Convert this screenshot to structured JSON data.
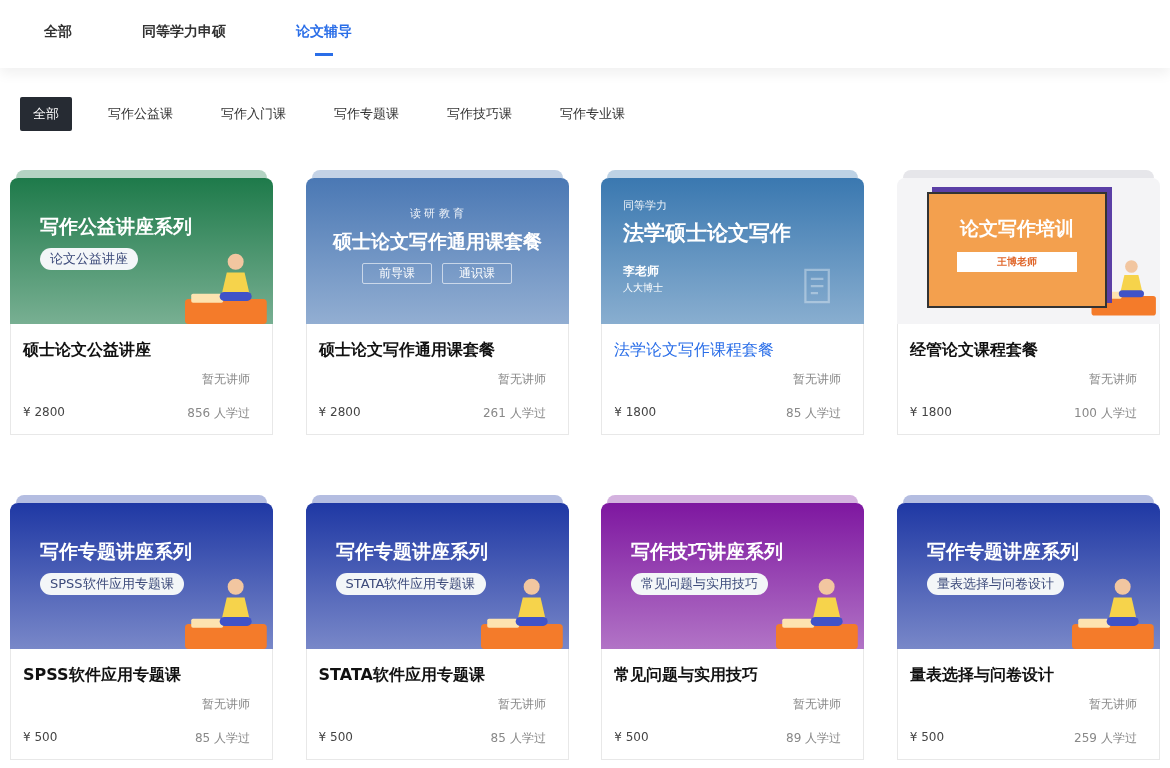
{
  "tabs": [
    {
      "label": "全部",
      "selected": false
    },
    {
      "label": "同等学力申硕",
      "selected": false
    },
    {
      "label": "论文辅导",
      "selected": true
    }
  ],
  "filters": [
    {
      "label": "全部",
      "selected": true
    },
    {
      "label": "写作公益课",
      "selected": false
    },
    {
      "label": "写作入门课",
      "selected": false
    },
    {
      "label": "写作专题课",
      "selected": false
    },
    {
      "label": "写作技巧课",
      "selected": false
    },
    {
      "label": "写作专业课",
      "selected": false
    }
  ],
  "courses": [
    {
      "title": "硕士论文公益讲座",
      "highlighted": false,
      "teacher": "暂无讲师",
      "price": "¥ 2800",
      "learners": "856 人学过",
      "banner": {
        "kind": "pill",
        "color": "#1e7a4a",
        "headline": "写作公益讲座系列",
        "tags": [
          "论文公益讲座"
        ]
      }
    },
    {
      "title": "硕士论文写作通用课套餐",
      "highlighted": false,
      "teacher": "暂无讲师",
      "price": "¥ 2800",
      "learners": "261 人学过",
      "banner": {
        "kind": "boxed",
        "color": "#4a78b4",
        "kicker": "读 研 教 育",
        "headline": "硕士论文写作通用课套餐",
        "tags": [
          "前导课",
          "通识课"
        ]
      }
    },
    {
      "title": "法学论文写作课程套餐",
      "highlighted": true,
      "teacher": "暂无讲师",
      "price": "¥ 1800",
      "learners": "85 人学过",
      "banner": {
        "kind": "plain",
        "color": "#3a78b0",
        "kicker": "同等学力",
        "headline": "法学硕士论文写作",
        "author": "李老师",
        "author_title": "人大博士"
      }
    },
    {
      "title": "经管论文课程套餐",
      "highlighted": false,
      "teacher": "暂无讲师",
      "price": "¥ 1800",
      "learners": "100 人学过",
      "banner": {
        "kind": "poster",
        "color": "#f3a04e",
        "headline": "论文写作培训",
        "tags": [
          "王博老师"
        ]
      }
    },
    {
      "title": "SPSS软件应用专题课",
      "highlighted": false,
      "teacher": "暂无讲师",
      "price": "¥ 500",
      "learners": "85 人学过",
      "banner": {
        "kind": "pill",
        "color": "#1f38a4",
        "headline": "写作专题讲座系列",
        "tags": [
          "SPSS软件应用专题课"
        ]
      }
    },
    {
      "title": "STATA软件应用专题课",
      "highlighted": false,
      "teacher": "暂无讲师",
      "price": "¥ 500",
      "learners": "85 人学过",
      "banner": {
        "kind": "pill",
        "color": "#1f38a4",
        "headline": "写作专题讲座系列",
        "tags": [
          "STATA软件应用专题课"
        ]
      }
    },
    {
      "title": "常见问题与实用技巧",
      "highlighted": false,
      "teacher": "暂无讲师",
      "price": "¥ 500",
      "learners": "89 人学过",
      "banner": {
        "kind": "pill",
        "color": "#7e17a0",
        "headline": "写作技巧讲座系列",
        "tags": [
          "常见问题与实用技巧"
        ]
      }
    },
    {
      "title": "量表选择与问卷设计",
      "highlighted": false,
      "teacher": "暂无讲师",
      "price": "¥ 500",
      "learners": "259 人学过",
      "banner": {
        "kind": "pill",
        "color": "#1f38a4",
        "headline": "写作专题讲座系列",
        "tags": [
          "量表选择与问卷设计"
        ]
      }
    }
  ]
}
